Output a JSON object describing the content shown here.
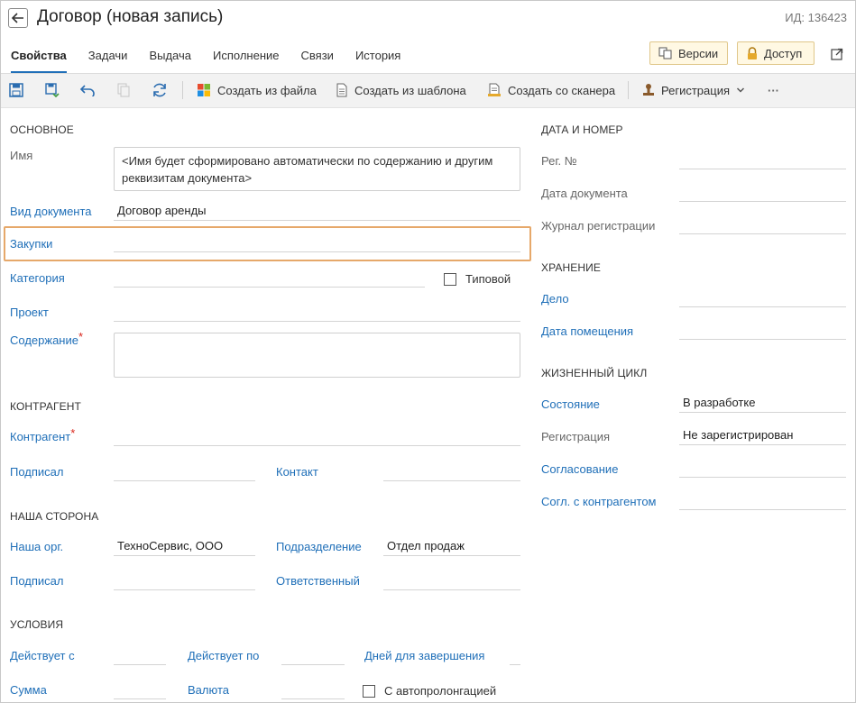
{
  "header": {
    "title": "Договор (новая запись)",
    "id_label": "ИД: 136423",
    "versions_label": "Версии",
    "access_label": "Доступ"
  },
  "tabs": [
    {
      "label": "Свойства",
      "active": true
    },
    {
      "label": "Задачи"
    },
    {
      "label": "Выдача"
    },
    {
      "label": "Исполнение"
    },
    {
      "label": "Связи"
    },
    {
      "label": "История"
    }
  ],
  "toolbar": {
    "create_from_file": "Создать из файла",
    "create_from_template": "Создать из шаблона",
    "create_from_scanner": "Создать со сканера",
    "registration": "Регистрация",
    "more": "···",
    "icons": [
      "save-icon",
      "save-close-icon",
      "undo-icon",
      "copy-icon",
      "refresh-icon"
    ]
  },
  "main": {
    "section": "ОСНОВНОЕ",
    "name_label": "Имя",
    "name_value": "<Имя будет сформировано автоматически по содержанию и другим реквизитам документа>",
    "doc_kind_label": "Вид документа",
    "doc_kind_value": "Договор аренды",
    "purchases_label": "Закупки",
    "purchases_value": "",
    "category_label": "Категория",
    "category_value": "",
    "typical_label": "Типовой",
    "project_label": "Проект",
    "project_value": "",
    "content_label": "Содержание",
    "content_value": "",
    "required_mark": "*"
  },
  "counterparty": {
    "section": "КОНТРАГЕНТ",
    "counterparty_label": "Контрагент",
    "counterparty_value": "",
    "signed_label": "Подписал",
    "signed_value": "",
    "contact_label": "Контакт",
    "contact_value": ""
  },
  "our_side": {
    "section": "НАША СТОРОНА",
    "org_label": "Наша орг.",
    "org_value": "ТехноСервис, ООО",
    "dept_label": "Подразделение",
    "dept_value": "Отдел продаж",
    "signed_label": "Подписал",
    "signed_value": "",
    "responsible_label": "Ответственный",
    "responsible_value": ""
  },
  "conditions": {
    "section": "УСЛОВИЯ",
    "valid_from_label": "Действует с",
    "valid_to_label": "Действует по",
    "days_label": "Дней для завершения",
    "sum_label": "Сумма",
    "currency_label": "Валюта",
    "autorenew_label": "С автопролонгацией"
  },
  "date_number": {
    "section": "ДАТА И НОМЕР",
    "reg_no_label": "Рег. №",
    "doc_date_label": "Дата документа",
    "journal_label": "Журнал регистрации"
  },
  "storage": {
    "section": "ХРАНЕНИЕ",
    "case_label": "Дело",
    "placement_date_label": "Дата помещения"
  },
  "lifecycle": {
    "section": "ЖИЗНЕННЫЙ ЦИКЛ",
    "state_label": "Состояние",
    "state_value": "В разработке",
    "registration_label": "Регистрация",
    "registration_value": "Не зарегистрирован",
    "approval_label": "Согласование",
    "approval_value": "",
    "cp_approval_label": "Согл. с контрагентом",
    "cp_approval_value": ""
  },
  "colors": {
    "accent": "#1f6fb8",
    "highlight": "#e6a86a",
    "required": "#d9261c",
    "header_button_bg": "#fff8e3"
  }
}
